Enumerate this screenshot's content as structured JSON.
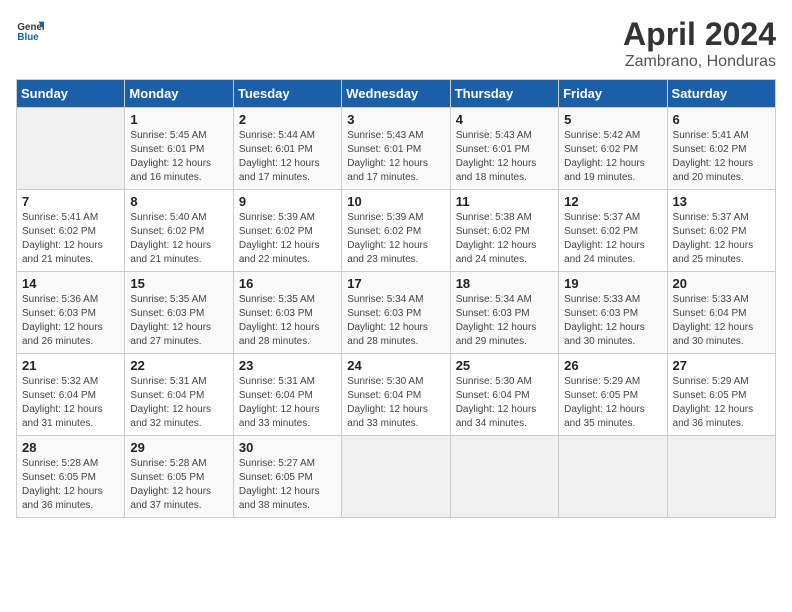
{
  "header": {
    "logo_general": "General",
    "logo_blue": "Blue",
    "title": "April 2024",
    "subtitle": "Zambrano, Honduras"
  },
  "columns": [
    "Sunday",
    "Monday",
    "Tuesday",
    "Wednesday",
    "Thursday",
    "Friday",
    "Saturday"
  ],
  "weeks": [
    [
      {
        "day": "",
        "info": ""
      },
      {
        "day": "1",
        "info": "Sunrise: 5:45 AM\nSunset: 6:01 PM\nDaylight: 12 hours\nand 16 minutes."
      },
      {
        "day": "2",
        "info": "Sunrise: 5:44 AM\nSunset: 6:01 PM\nDaylight: 12 hours\nand 17 minutes."
      },
      {
        "day": "3",
        "info": "Sunrise: 5:43 AM\nSunset: 6:01 PM\nDaylight: 12 hours\nand 17 minutes."
      },
      {
        "day": "4",
        "info": "Sunrise: 5:43 AM\nSunset: 6:01 PM\nDaylight: 12 hours\nand 18 minutes."
      },
      {
        "day": "5",
        "info": "Sunrise: 5:42 AM\nSunset: 6:02 PM\nDaylight: 12 hours\nand 19 minutes."
      },
      {
        "day": "6",
        "info": "Sunrise: 5:41 AM\nSunset: 6:02 PM\nDaylight: 12 hours\nand 20 minutes."
      }
    ],
    [
      {
        "day": "7",
        "info": "Sunrise: 5:41 AM\nSunset: 6:02 PM\nDaylight: 12 hours\nand 21 minutes."
      },
      {
        "day": "8",
        "info": "Sunrise: 5:40 AM\nSunset: 6:02 PM\nDaylight: 12 hours\nand 21 minutes."
      },
      {
        "day": "9",
        "info": "Sunrise: 5:39 AM\nSunset: 6:02 PM\nDaylight: 12 hours\nand 22 minutes."
      },
      {
        "day": "10",
        "info": "Sunrise: 5:39 AM\nSunset: 6:02 PM\nDaylight: 12 hours\nand 23 minutes."
      },
      {
        "day": "11",
        "info": "Sunrise: 5:38 AM\nSunset: 6:02 PM\nDaylight: 12 hours\nand 24 minutes."
      },
      {
        "day": "12",
        "info": "Sunrise: 5:37 AM\nSunset: 6:02 PM\nDaylight: 12 hours\nand 24 minutes."
      },
      {
        "day": "13",
        "info": "Sunrise: 5:37 AM\nSunset: 6:02 PM\nDaylight: 12 hours\nand 25 minutes."
      }
    ],
    [
      {
        "day": "14",
        "info": "Sunrise: 5:36 AM\nSunset: 6:03 PM\nDaylight: 12 hours\nand 26 minutes."
      },
      {
        "day": "15",
        "info": "Sunrise: 5:35 AM\nSunset: 6:03 PM\nDaylight: 12 hours\nand 27 minutes."
      },
      {
        "day": "16",
        "info": "Sunrise: 5:35 AM\nSunset: 6:03 PM\nDaylight: 12 hours\nand 28 minutes."
      },
      {
        "day": "17",
        "info": "Sunrise: 5:34 AM\nSunset: 6:03 PM\nDaylight: 12 hours\nand 28 minutes."
      },
      {
        "day": "18",
        "info": "Sunrise: 5:34 AM\nSunset: 6:03 PM\nDaylight: 12 hours\nand 29 minutes."
      },
      {
        "day": "19",
        "info": "Sunrise: 5:33 AM\nSunset: 6:03 PM\nDaylight: 12 hours\nand 30 minutes."
      },
      {
        "day": "20",
        "info": "Sunrise: 5:33 AM\nSunset: 6:04 PM\nDaylight: 12 hours\nand 30 minutes."
      }
    ],
    [
      {
        "day": "21",
        "info": "Sunrise: 5:32 AM\nSunset: 6:04 PM\nDaylight: 12 hours\nand 31 minutes."
      },
      {
        "day": "22",
        "info": "Sunrise: 5:31 AM\nSunset: 6:04 PM\nDaylight: 12 hours\nand 32 minutes."
      },
      {
        "day": "23",
        "info": "Sunrise: 5:31 AM\nSunset: 6:04 PM\nDaylight: 12 hours\nand 33 minutes."
      },
      {
        "day": "24",
        "info": "Sunrise: 5:30 AM\nSunset: 6:04 PM\nDaylight: 12 hours\nand 33 minutes."
      },
      {
        "day": "25",
        "info": "Sunrise: 5:30 AM\nSunset: 6:04 PM\nDaylight: 12 hours\nand 34 minutes."
      },
      {
        "day": "26",
        "info": "Sunrise: 5:29 AM\nSunset: 6:05 PM\nDaylight: 12 hours\nand 35 minutes."
      },
      {
        "day": "27",
        "info": "Sunrise: 5:29 AM\nSunset: 6:05 PM\nDaylight: 12 hours\nand 36 minutes."
      }
    ],
    [
      {
        "day": "28",
        "info": "Sunrise: 5:28 AM\nSunset: 6:05 PM\nDaylight: 12 hours\nand 36 minutes."
      },
      {
        "day": "29",
        "info": "Sunrise: 5:28 AM\nSunset: 6:05 PM\nDaylight: 12 hours\nand 37 minutes."
      },
      {
        "day": "30",
        "info": "Sunrise: 5:27 AM\nSunset: 6:05 PM\nDaylight: 12 hours\nand 38 minutes."
      },
      {
        "day": "",
        "info": ""
      },
      {
        "day": "",
        "info": ""
      },
      {
        "day": "",
        "info": ""
      },
      {
        "day": "",
        "info": ""
      }
    ]
  ]
}
